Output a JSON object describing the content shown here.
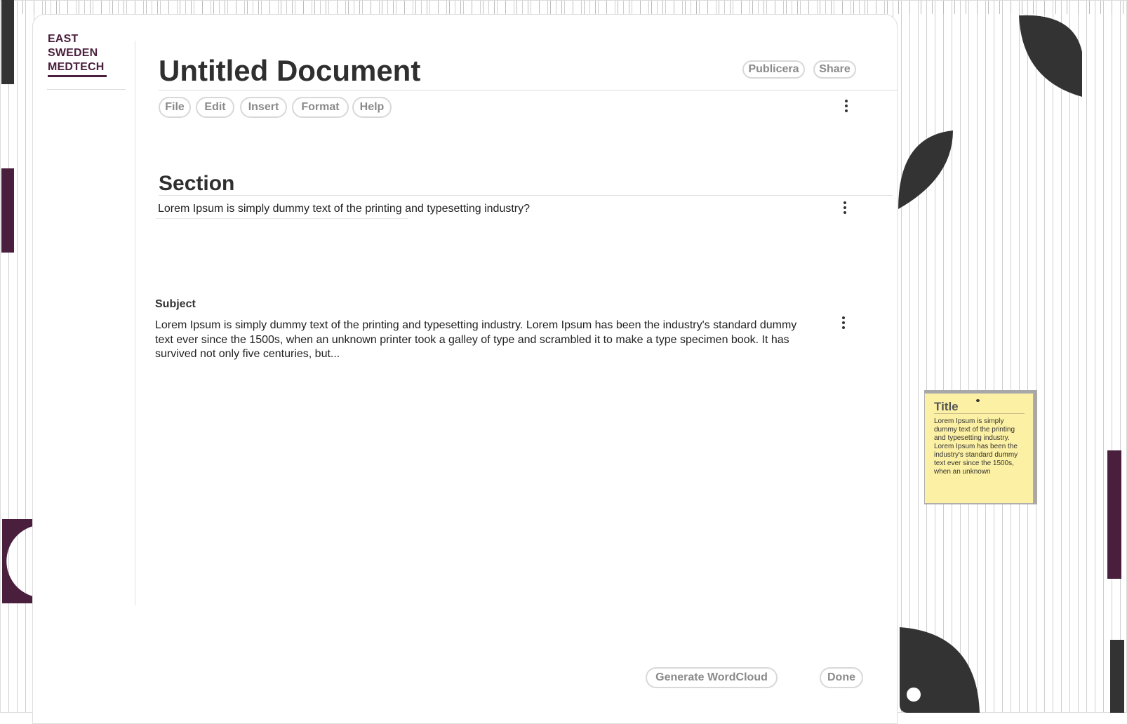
{
  "brand": {
    "logo_lines": [
      "EAST",
      "SWEDEN",
      "MEDTECH"
    ]
  },
  "document": {
    "title": "Untitled Document",
    "header_buttons": {
      "publish": "Publicera",
      "share": "Share"
    },
    "menu": [
      "File",
      "Edit",
      "Insert",
      "Format",
      "Help"
    ]
  },
  "section": {
    "heading": "Section",
    "text": "Lorem Ipsum is simply dummy text of the printing and typesetting industry?"
  },
  "subject": {
    "label": "Subject",
    "text": "Lorem Ipsum is simply dummy text of the printing and typesetting industry. Lorem Ipsum has been the industry's standard dummy text ever since the 1500s, when an unknown printer took a galley of type and scrambled it to make a type specimen book. It has survived not only five centuries, but..."
  },
  "footer_buttons": {
    "wordcloud": "Generate WordCloud",
    "done": "Done"
  },
  "sticky_note": {
    "title": "Title",
    "text": "Lorem Ipsum is simply dummy text of the printing and typesetting industry. Lorem Ipsum has been the industry's standard dummy text ever since the 1500s, when an unknown"
  },
  "icons": {
    "more_menu": "more-vertical-icon"
  },
  "colors": {
    "brand_plum": "#4a1f3d",
    "dark_shape": "#333333",
    "sticky_yellow": "#fcf0a4",
    "pill_text": "#8a8a8a"
  }
}
